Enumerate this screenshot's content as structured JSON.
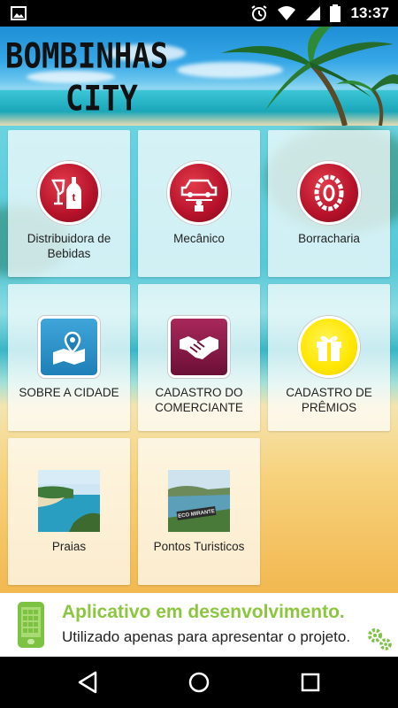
{
  "status_bar": {
    "time": "13:37",
    "icons": [
      "image-icon",
      "alarm-icon",
      "wifi-icon",
      "signal-icon",
      "battery-icon"
    ]
  },
  "header": {
    "title_line1": "BOMBINHAS",
    "title_line2": "CITY"
  },
  "menu": {
    "items": [
      {
        "label": "Distribuidora de Bebidas",
        "icon": "drinks-icon"
      },
      {
        "label": "Mecânico",
        "icon": "mechanic-icon"
      },
      {
        "label": "Borracharia",
        "icon": "tire-icon"
      },
      {
        "label": "SOBRE A CIDADE",
        "icon": "map-pin-icon"
      },
      {
        "label": "CADASTRO DO COMERCIANTE",
        "icon": "handshake-icon"
      },
      {
        "label": "CADASTRO DE PRÊMIOS",
        "icon": "gift-icon"
      },
      {
        "label": "Praias",
        "icon": "beach-photo"
      },
      {
        "label": "Pontos Turisticos",
        "icon": "tourist-spot-photo"
      }
    ]
  },
  "dev_banner": {
    "title": "Aplicativo em desenvolvimento.",
    "subtitle": "Utilizado apenas para apresentar o projeto."
  },
  "photo_texts": {
    "sign": "ECO MIRANTE"
  },
  "colors": {
    "accent_green": "#8cc63f",
    "icon_red": "#b5122a",
    "icon_blue": "#1f7fb8",
    "icon_maroon": "#6b0f36",
    "icon_yellow": "#ffe600"
  },
  "nav_bar": {
    "buttons": [
      "back-icon",
      "home-icon",
      "recents-icon"
    ]
  }
}
